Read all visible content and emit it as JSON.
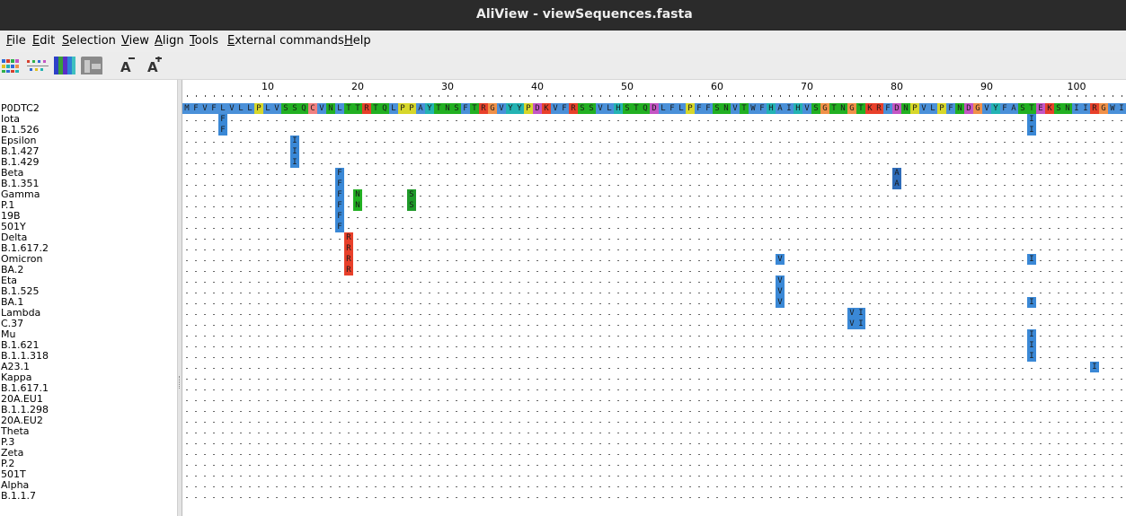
{
  "window": {
    "title": "AliView - viewSequences.fasta"
  },
  "menu": [
    "File",
    "Edit",
    "Selection",
    "View",
    "Align",
    "Tools",
    "External commands",
    "Help"
  ],
  "toolbar": {
    "icons": [
      "color-scheme-icon",
      "consensus-dots-icon",
      "translate-icon",
      "hide-icon",
      "font-smaller-icon",
      "font-larger-icon"
    ]
  },
  "ruler": {
    "labels": [
      "10",
      "20",
      "30",
      "40",
      "50",
      "60",
      "70",
      "80",
      "90",
      "100"
    ],
    "label_positions": [
      10,
      20,
      30,
      40,
      50,
      60,
      70,
      80,
      90,
      100
    ]
  },
  "reference": {
    "name": "P0DTC2",
    "sequence": "MFVFLVLLPLVSSQCVNLTTRTQLPPAYTNSFTRGVYYPDKVFRSSVLHSTQDLFLPFFSNVTWFHAIHVSGTNGTKRFDNPVLPFNDGVYFASTEKSNIIRGWI"
  },
  "sequences": [
    {
      "name": "Iota",
      "mutations": [
        {
          "pos": 5,
          "aa": "F"
        },
        {
          "pos": 95,
          "aa": "I"
        }
      ]
    },
    {
      "name": "B.1.526",
      "mutations": [
        {
          "pos": 5,
          "aa": "F"
        },
        {
          "pos": 95,
          "aa": "I"
        }
      ]
    },
    {
      "name": "Epsilon",
      "mutations": [
        {
          "pos": 13,
          "aa": "I"
        }
      ]
    },
    {
      "name": "B.1.427",
      "mutations": [
        {
          "pos": 13,
          "aa": "I"
        }
      ]
    },
    {
      "name": "B.1.429",
      "mutations": [
        {
          "pos": 13,
          "aa": "I"
        }
      ]
    },
    {
      "name": "Beta",
      "mutations": [
        {
          "pos": 18,
          "aa": "F"
        },
        {
          "pos": 80,
          "aa": "A"
        }
      ]
    },
    {
      "name": "B.1.351",
      "mutations": [
        {
          "pos": 18,
          "aa": "F"
        },
        {
          "pos": 80,
          "aa": "A"
        }
      ]
    },
    {
      "name": "Gamma",
      "mutations": [
        {
          "pos": 18,
          "aa": "F"
        },
        {
          "pos": 20,
          "aa": "N"
        },
        {
          "pos": 26,
          "aa": "S"
        }
      ]
    },
    {
      "name": "P.1",
      "mutations": [
        {
          "pos": 18,
          "aa": "F"
        },
        {
          "pos": 20,
          "aa": "N"
        },
        {
          "pos": 26,
          "aa": "S"
        }
      ]
    },
    {
      "name": "19B",
      "mutations": [
        {
          "pos": 18,
          "aa": "F"
        }
      ]
    },
    {
      "name": "501Y",
      "mutations": [
        {
          "pos": 18,
          "aa": "F"
        }
      ]
    },
    {
      "name": "Delta",
      "mutations": [
        {
          "pos": 19,
          "aa": "R"
        }
      ]
    },
    {
      "name": "B.1.617.2",
      "mutations": [
        {
          "pos": 19,
          "aa": "R"
        }
      ]
    },
    {
      "name": "Omicron",
      "mutations": [
        {
          "pos": 19,
          "aa": "R"
        },
        {
          "pos": 67,
          "aa": "V"
        },
        {
          "pos": 95,
          "aa": "I"
        }
      ]
    },
    {
      "name": "BA.2",
      "mutations": [
        {
          "pos": 19,
          "aa": "R"
        }
      ]
    },
    {
      "name": "Eta",
      "mutations": [
        {
          "pos": 67,
          "aa": "V"
        }
      ]
    },
    {
      "name": "B.1.525",
      "mutations": [
        {
          "pos": 67,
          "aa": "V"
        }
      ]
    },
    {
      "name": "BA.1",
      "mutations": [
        {
          "pos": 67,
          "aa": "V"
        },
        {
          "pos": 95,
          "aa": "I"
        }
      ]
    },
    {
      "name": "Lambda",
      "mutations": [
        {
          "pos": 75,
          "aa": "V"
        },
        {
          "pos": 76,
          "aa": "I"
        }
      ]
    },
    {
      "name": "C.37",
      "mutations": [
        {
          "pos": 75,
          "aa": "V"
        },
        {
          "pos": 76,
          "aa": "I"
        }
      ]
    },
    {
      "name": "Mu",
      "mutations": [
        {
          "pos": 95,
          "aa": "I"
        }
      ]
    },
    {
      "name": "B.1.621",
      "mutations": [
        {
          "pos": 95,
          "aa": "I"
        }
      ]
    },
    {
      "name": "B.1.1.318",
      "mutations": [
        {
          "pos": 95,
          "aa": "I"
        }
      ]
    },
    {
      "name": "A23.1",
      "mutations": [
        {
          "pos": 102,
          "aa": "I"
        }
      ]
    },
    {
      "name": "Kappa",
      "mutations": []
    },
    {
      "name": "B.1.617.1",
      "mutations": []
    },
    {
      "name": "20A.EU1",
      "mutations": []
    },
    {
      "name": "B.1.1.298",
      "mutations": []
    },
    {
      "name": "20A.EU2",
      "mutations": []
    },
    {
      "name": "Theta",
      "mutations": []
    },
    {
      "name": "P.3",
      "mutations": []
    },
    {
      "name": "Zeta",
      "mutations": []
    },
    {
      "name": "P.2",
      "mutations": []
    },
    {
      "name": "501T",
      "mutations": []
    },
    {
      "name": "Alpha",
      "mutations": []
    },
    {
      "name": "B.1.1.7",
      "mutations": []
    }
  ],
  "colors": {
    "titlebar": "#2b2b2b",
    "hydrophobic": "#4a90d9",
    "positive": "#e8402a",
    "negative": "#c455c4",
    "polar": "#22b022",
    "glycine": "#f09048",
    "proline": "#d7d72a",
    "aromatic": "#23b3b3",
    "cysteine": "#f08080"
  }
}
